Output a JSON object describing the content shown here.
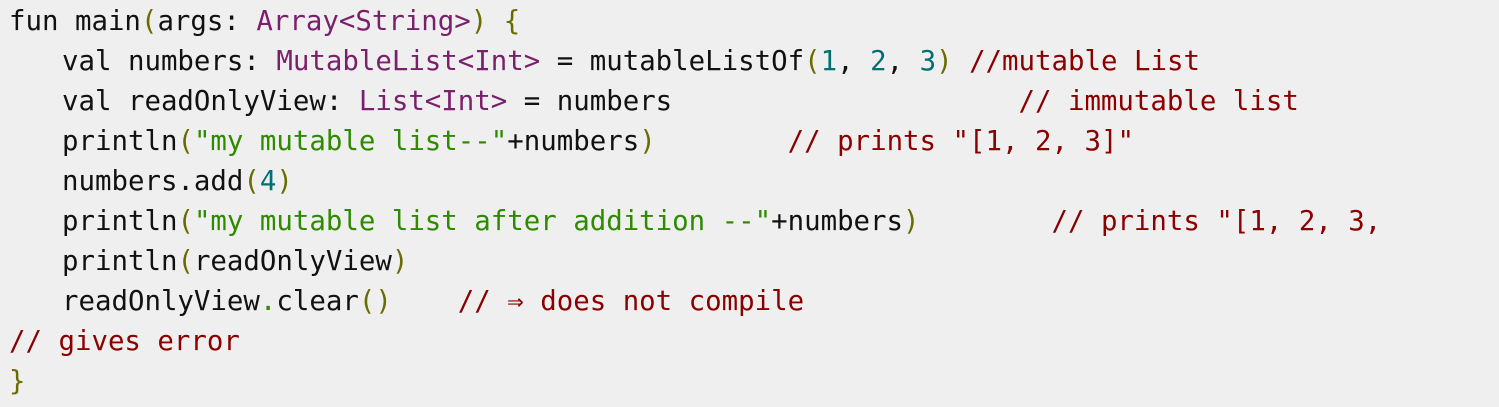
{
  "colors": {
    "background": "#efefef",
    "plain": "#111111",
    "type": "#7a1f6b",
    "paren": "#6b6b00",
    "number": "#007070",
    "string": "#2e8b00",
    "comment": "#8b0000",
    "member_dot": "#2e8b00"
  },
  "code": {
    "lines": [
      {
        "indent": 0,
        "tokens": [
          {
            "text": "fun main",
            "role": "plain"
          },
          {
            "text": "(",
            "role": "paren"
          },
          {
            "text": "args: ",
            "role": "plain"
          },
          {
            "text": "Array<String>",
            "role": "type"
          },
          {
            "text": ") {",
            "role": "paren"
          }
        ]
      },
      {
        "indent": 1,
        "tokens": [
          {
            "text": "val numbers: ",
            "role": "plain"
          },
          {
            "text": "MutableList<Int>",
            "role": "type"
          },
          {
            "text": " = mutableListOf",
            "role": "plain"
          },
          {
            "text": "(",
            "role": "paren"
          },
          {
            "text": "1",
            "role": "number"
          },
          {
            "text": ", ",
            "role": "plain"
          },
          {
            "text": "2",
            "role": "number"
          },
          {
            "text": ", ",
            "role": "plain"
          },
          {
            "text": "3",
            "role": "number"
          },
          {
            "text": ")",
            "role": "paren"
          },
          {
            "text": " //mutable List",
            "role": "comment"
          }
        ]
      },
      {
        "indent": 1,
        "tokens": [
          {
            "text": "val readOnlyView: ",
            "role": "plain"
          },
          {
            "text": "List<Int>",
            "role": "type"
          },
          {
            "text": " = numbers                     ",
            "role": "plain"
          },
          {
            "text": "// immutable list",
            "role": "comment"
          }
        ]
      },
      {
        "indent": 1,
        "tokens": [
          {
            "text": "println",
            "role": "plain"
          },
          {
            "text": "(",
            "role": "paren"
          },
          {
            "text": "\"my mutable list--\"",
            "role": "string"
          },
          {
            "text": "+numbers",
            "role": "plain"
          },
          {
            "text": ")",
            "role": "paren"
          },
          {
            "text": "        // prints \"[1, 2, 3]\"",
            "role": "comment"
          }
        ]
      },
      {
        "indent": 1,
        "tokens": [
          {
            "text": "numbers.add",
            "role": "plain"
          },
          {
            "text": "(",
            "role": "paren"
          },
          {
            "text": "4",
            "role": "number"
          },
          {
            "text": ")",
            "role": "paren"
          }
        ]
      },
      {
        "indent": 1,
        "tokens": [
          {
            "text": "println",
            "role": "plain"
          },
          {
            "text": "(",
            "role": "paren"
          },
          {
            "text": "\"my mutable list after addition --\"",
            "role": "string"
          },
          {
            "text": "+numbers",
            "role": "plain"
          },
          {
            "text": ")",
            "role": "paren"
          },
          {
            "text": "        // prints \"[1, 2, 3,",
            "role": "comment"
          }
        ]
      },
      {
        "indent": 1,
        "tokens": [
          {
            "text": "println",
            "role": "plain"
          },
          {
            "text": "(",
            "role": "paren"
          },
          {
            "text": "readOnlyView",
            "role": "plain"
          },
          {
            "text": ")",
            "role": "paren"
          }
        ]
      },
      {
        "indent": 1,
        "tokens": [
          {
            "text": "readOnlyView",
            "role": "plain"
          },
          {
            "text": ".",
            "role": "member_dot"
          },
          {
            "text": "clear",
            "role": "plain"
          },
          {
            "text": "()",
            "role": "paren"
          },
          {
            "text": "    // ⇒ does not compile",
            "role": "comment"
          }
        ]
      },
      {
        "indent": 0,
        "tokens": [
          {
            "text": "// gives error",
            "role": "comment"
          }
        ]
      },
      {
        "indent": 0,
        "tokens": [
          {
            "text": "}",
            "role": "paren"
          }
        ]
      }
    ]
  }
}
